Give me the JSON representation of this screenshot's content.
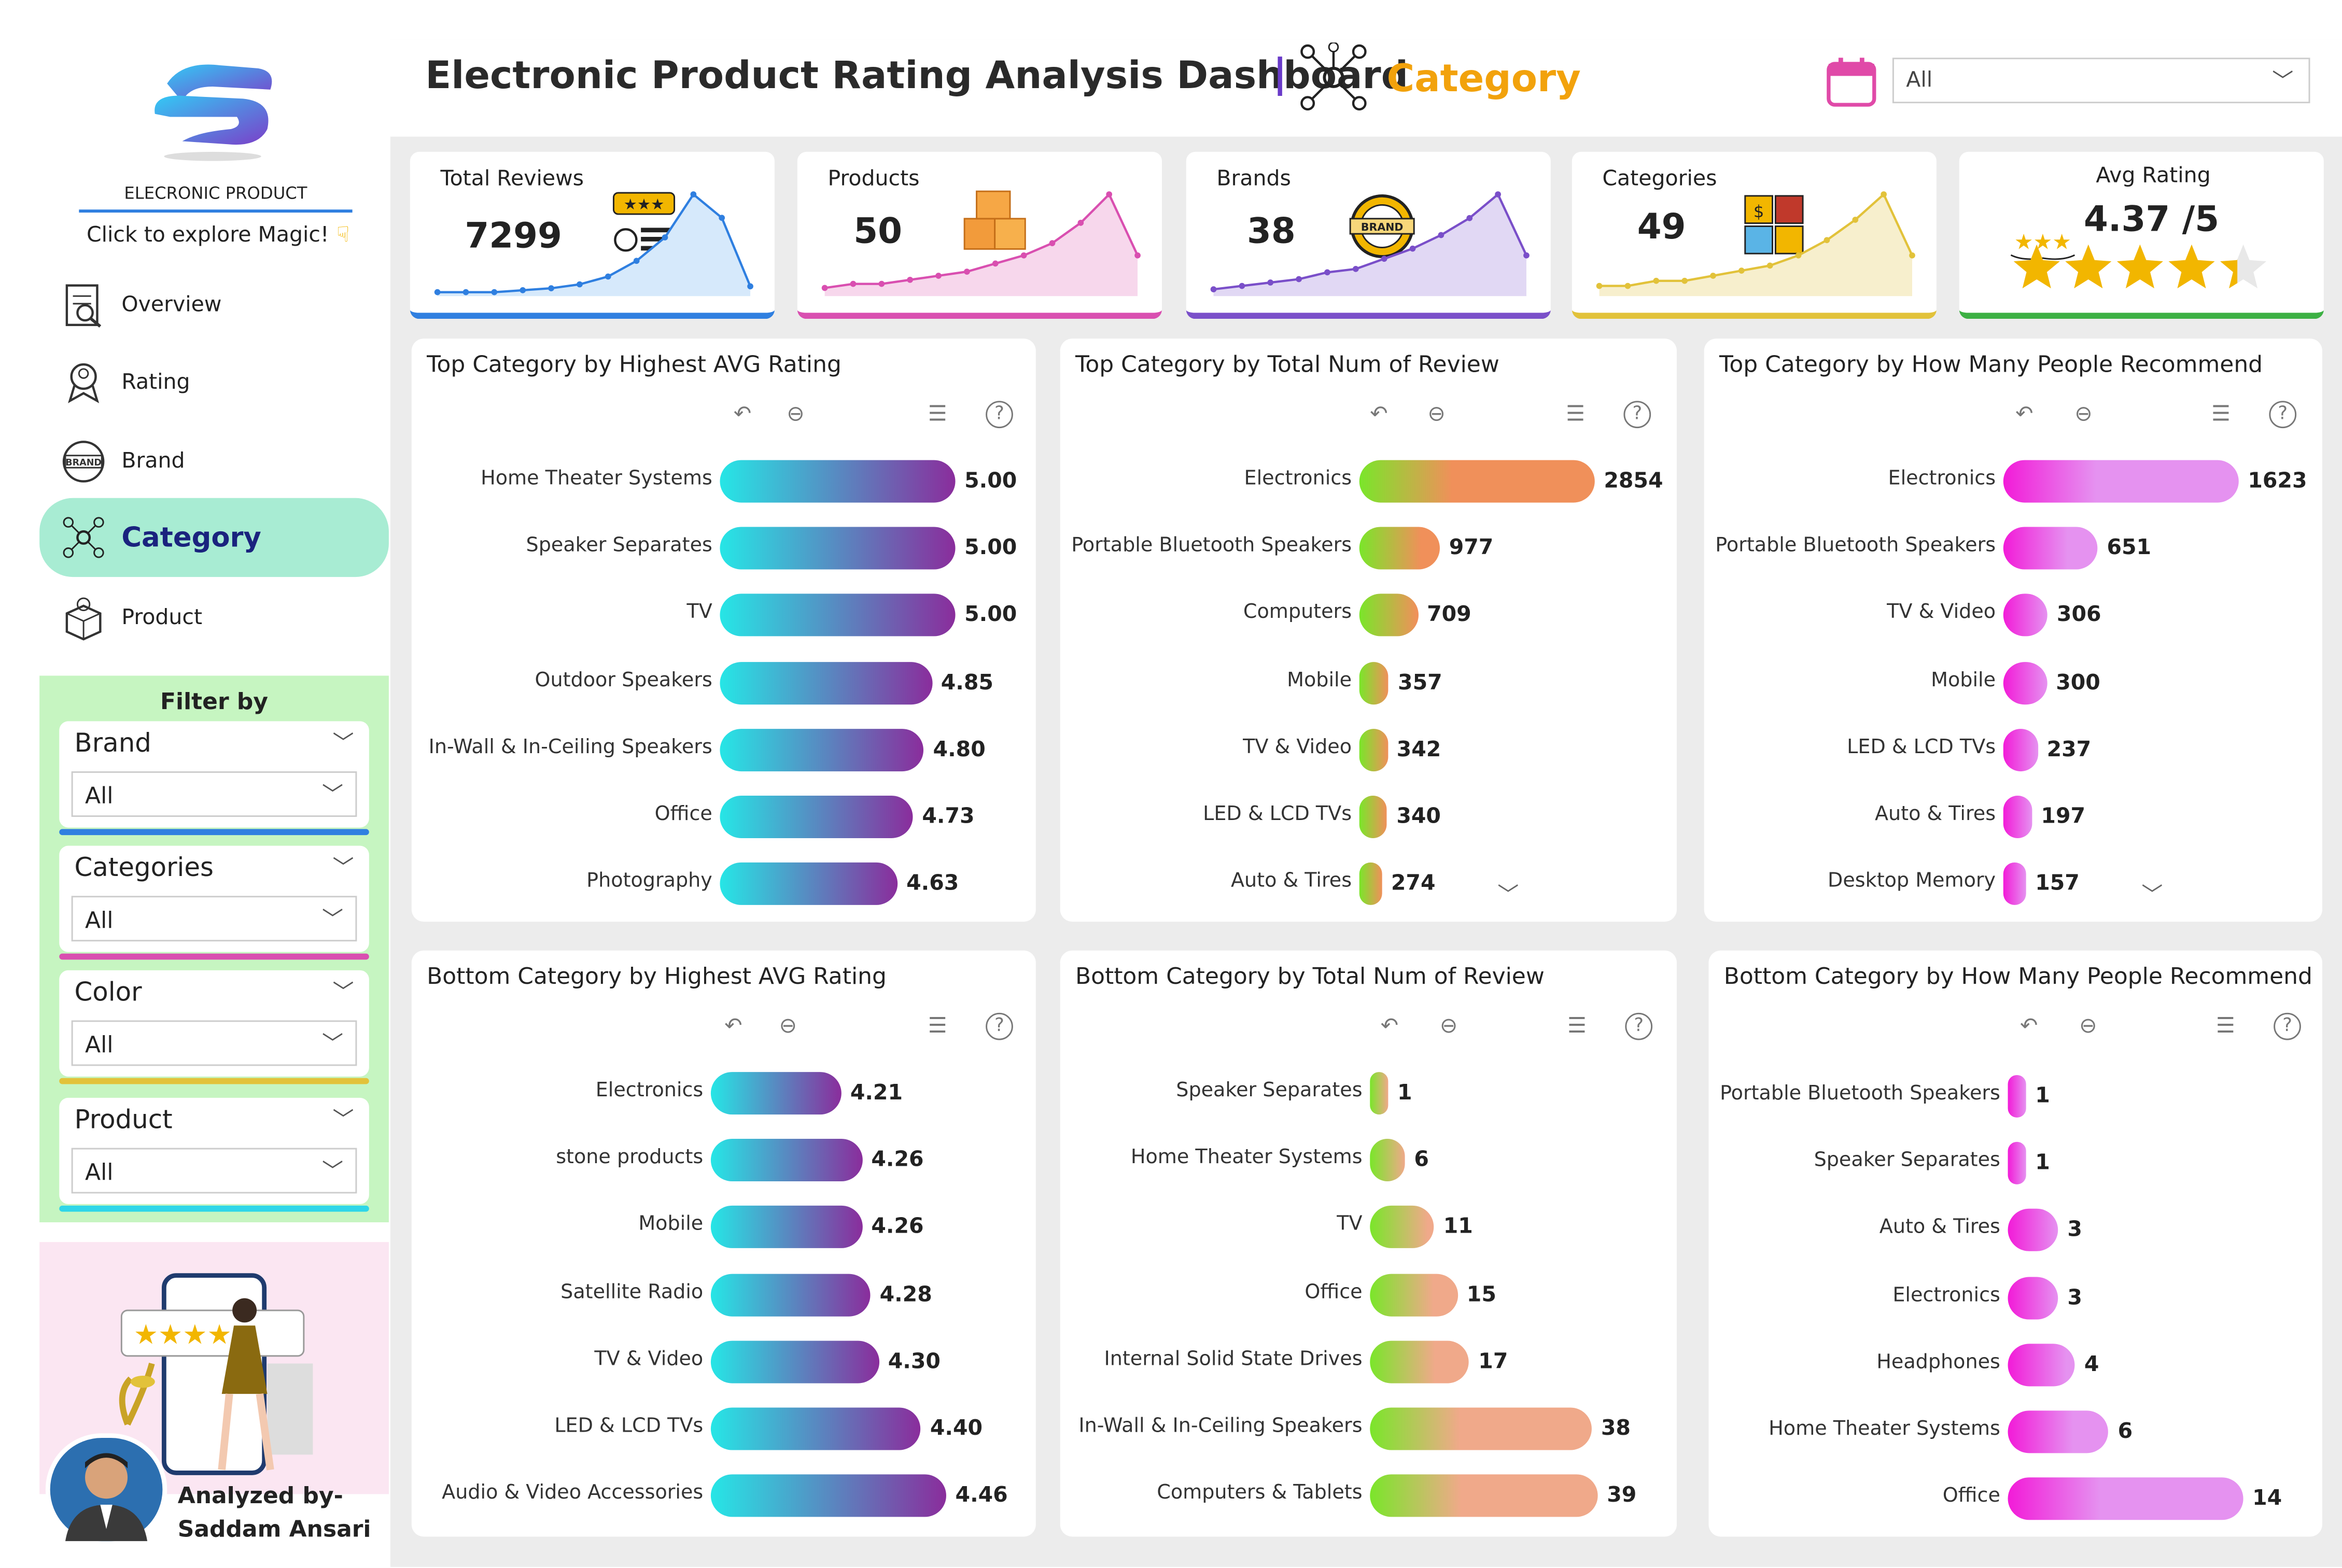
{
  "header": {
    "title": "Electronic Product Rating Analysis Dashboard",
    "separator": "|",
    "page_name": "Category",
    "date_filter_value": "All"
  },
  "sidebar": {
    "logo_text": "ELECRONIC PRODUCT",
    "tagline": "Click to explore Magic!",
    "nav": [
      {
        "label": "Overview",
        "icon": "report-icon"
      },
      {
        "label": "Rating",
        "icon": "rating-badge-icon"
      },
      {
        "label": "Brand",
        "icon": "brand-badge-icon"
      },
      {
        "label": "Category",
        "icon": "category-network-icon",
        "active": true
      },
      {
        "label": "Product",
        "icon": "product-box-icon"
      }
    ],
    "filter_title": "Filter by",
    "filters": [
      {
        "label": "Brand",
        "value": "All",
        "color": "#2f7fe0"
      },
      {
        "label": "Categories",
        "value": "All",
        "color": "#d94fb0"
      },
      {
        "label": "Color",
        "value": "All",
        "color": "#e2c23a"
      },
      {
        "label": "Product",
        "value": "All",
        "color": "#2fd6e8"
      }
    ],
    "author_line1": "Analyzed by-",
    "author_line2": "Saddam Ansari"
  },
  "kpis": [
    {
      "label": "Total Reviews",
      "value": "7299",
      "color": "#2f7fe0",
      "fill": "#d6e9fb",
      "spark": [
        2,
        2,
        2,
        3,
        4,
        6,
        10,
        18,
        30,
        52,
        40,
        5
      ]
    },
    {
      "label": "Products",
      "value": "50",
      "color": "#d94fb0",
      "fill": "#f7d7ec",
      "spark": [
        2,
        3,
        3,
        4,
        5,
        6,
        8,
        10,
        13,
        18,
        25,
        10
      ]
    },
    {
      "label": "Brands",
      "value": "38",
      "color": "#7a4fc9",
      "fill": "#e1d8f4",
      "spark": [
        2,
        3,
        4,
        5,
        7,
        8,
        11,
        14,
        18,
        23,
        30,
        12
      ]
    },
    {
      "label": "Categories",
      "value": "49",
      "color": "#e2c23a",
      "fill": "#f7efcd",
      "spark": [
        2,
        2,
        3,
        3,
        4,
        5,
        6,
        8,
        11,
        15,
        20,
        8
      ]
    },
    {
      "label": "Avg Rating",
      "value": "4.37 /5",
      "color": "#3cb043",
      "stars": 4.37
    }
  ],
  "charts": {
    "top_avg": {
      "title": "Top Category by Highest AVG Rating",
      "colors": [
        "#26e6e6",
        "#8a2d9c"
      ],
      "max": 5.0,
      "rows": [
        {
          "label": "Home Theater Systems",
          "value": "5.00",
          "n": 5.0
        },
        {
          "label": "Speaker Separates",
          "value": "5.00",
          "n": 5.0
        },
        {
          "label": "TV",
          "value": "5.00",
          "n": 5.0
        },
        {
          "label": "Outdoor Speakers",
          "value": "4.85",
          "n": 4.85
        },
        {
          "label": "In-Wall & In-Ceiling Speakers",
          "value": "4.80",
          "n": 4.8
        },
        {
          "label": "Office",
          "value": "4.73",
          "n": 4.73
        },
        {
          "label": "Photography",
          "value": "4.63",
          "n": 4.63
        }
      ]
    },
    "top_reviews": {
      "title": "Top Category by Total Num of Review",
      "colors": [
        "#7ae62a",
        "#f0905a"
      ],
      "max": 2854,
      "rows": [
        {
          "label": "Electronics",
          "value": "2854",
          "n": 2854
        },
        {
          "label": "Portable Bluetooth Speakers",
          "value": "977",
          "n": 977
        },
        {
          "label": "Computers",
          "value": "709",
          "n": 709
        },
        {
          "label": "Mobile",
          "value": "357",
          "n": 357
        },
        {
          "label": "TV & Video",
          "value": "342",
          "n": 342
        },
        {
          "label": "LED & LCD TVs",
          "value": "340",
          "n": 340
        },
        {
          "label": "Auto & Tires",
          "value": "274",
          "n": 274
        }
      ]
    },
    "top_recommend": {
      "title": "Top Category by How Many People Recommend",
      "colors": [
        "#f21bd8",
        "#e592f0"
      ],
      "max": 1623,
      "rows": [
        {
          "label": "Electronics",
          "value": "1623",
          "n": 1623
        },
        {
          "label": "Portable Bluetooth Speakers",
          "value": "651",
          "n": 651
        },
        {
          "label": "TV & Video",
          "value": "306",
          "n": 306
        },
        {
          "label": "Mobile",
          "value": "300",
          "n": 300
        },
        {
          "label": "LED & LCD TVs",
          "value": "237",
          "n": 237
        },
        {
          "label": "Auto & Tires",
          "value": "197",
          "n": 197
        },
        {
          "label": "Desktop Memory",
          "value": "157",
          "n": 157
        }
      ]
    },
    "bottom_avg": {
      "title": "Bottom Category by Highest AVG Rating",
      "colors": [
        "#26e6e6",
        "#8a2d9c"
      ],
      "max": 4.46,
      "rows": [
        {
          "label": "Electronics",
          "value": "4.21",
          "n": 4.21
        },
        {
          "label": "stone products",
          "value": "4.26",
          "n": 4.26
        },
        {
          "label": "Mobile",
          "value": "4.26",
          "n": 4.26
        },
        {
          "label": "Satellite Radio",
          "value": "4.28",
          "n": 4.28
        },
        {
          "label": "TV & Video",
          "value": "4.30",
          "n": 4.3
        },
        {
          "label": "LED & LCD TVs",
          "value": "4.40",
          "n": 4.4
        },
        {
          "label": "Audio & Video Accessories",
          "value": "4.46",
          "n": 4.46
        }
      ]
    },
    "bottom_reviews": {
      "title": "Bottom Category by Total Num of Review",
      "colors": [
        "#7ae62a",
        "#f0a98a"
      ],
      "max": 39,
      "rows": [
        {
          "label": "Speaker Separates",
          "value": "1",
          "n": 1
        },
        {
          "label": "Home Theater Systems",
          "value": "6",
          "n": 6
        },
        {
          "label": "TV",
          "value": "11",
          "n": 11
        },
        {
          "label": "Office",
          "value": "15",
          "n": 15
        },
        {
          "label": "Internal Solid State Drives",
          "value": "17",
          "n": 17
        },
        {
          "label": "In-Wall & In-Ceiling Speakers",
          "value": "38",
          "n": 38
        },
        {
          "label": "Computers & Tablets",
          "value": "39",
          "n": 39
        }
      ]
    },
    "bottom_recommend": {
      "title": "Bottom Category by How Many People Recommend",
      "colors": [
        "#f21bd8",
        "#e592f0"
      ],
      "max": 14,
      "rows": [
        {
          "label": "Portable Bluetooth Speakers",
          "value": "1",
          "n": 1
        },
        {
          "label": "Speaker Separates",
          "value": "1",
          "n": 1
        },
        {
          "label": "Auto & Tires",
          "value": "3",
          "n": 3
        },
        {
          "label": "Electronics",
          "value": "3",
          "n": 3
        },
        {
          "label": "Headphones",
          "value": "4",
          "n": 4
        },
        {
          "label": "Home Theater Systems",
          "value": "6",
          "n": 6
        },
        {
          "label": "Office",
          "value": "14",
          "n": 14
        }
      ]
    }
  }
}
